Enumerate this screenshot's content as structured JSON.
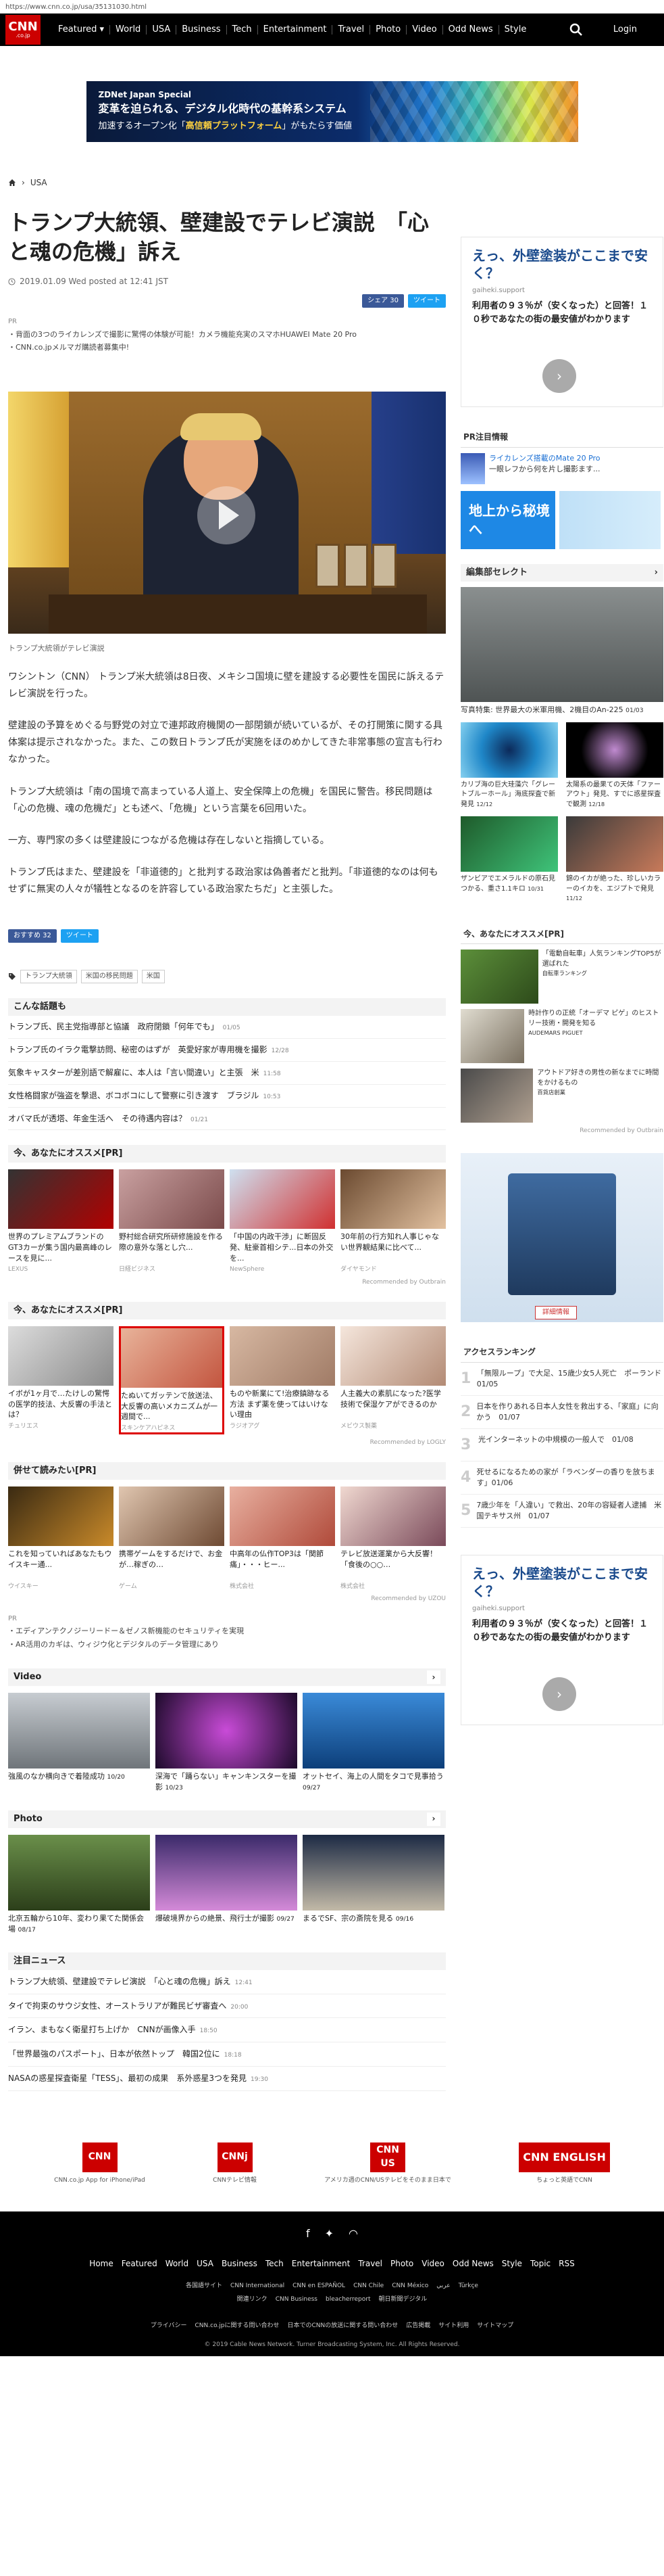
{
  "url": "https://www.cnn.co.jp/usa/35131030.html",
  "brand": {
    "logo": "CNN",
    "logo_sub": ".co.jp",
    "accent": "#cc0000"
  },
  "nav": {
    "items": [
      "Featured ▾",
      "World",
      "USA",
      "Business",
      "Tech",
      "Entertainment",
      "Travel",
      "Photo",
      "Video",
      "Odd News",
      "Style"
    ],
    "login": "Login"
  },
  "banner": {
    "l1": "ZDNet Japan Special",
    "l2": "変革を迫られる、デジタル化時代の基幹系システム",
    "l3a": "加速するオープン化「",
    "l3b": "高信頼プラットフォーム",
    "l3c": "」がもたらす価値"
  },
  "breadcrumb": {
    "home_icon": "home-icon",
    "section": "USA"
  },
  "article": {
    "title": "トランプ大統領、壁建設でテレビ演説　「心と魂の危機」訴え",
    "date": "2019.01.09 Wed posted at 12:41 JST",
    "share_fb": "シェア 30",
    "share_tw": "ツイート",
    "pr_label": "PR",
    "pr1": "・背面の3つのライカレンズで撮影に驚愕の体験が可能！カメラ機能充実のスマホHUAWEI Mate 20 Pro",
    "pr2": "・CNN.co.jpメルマガ購読者募集中!",
    "caption": "トランプ大統領がテレビ演説",
    "p1": "ワシントン（CNN） トランプ米大統領は8日夜、メキシコ国境に壁を建設する必要性を国民に訴えるテレビ演説を行った。",
    "p2": "壁建設の予算をめぐる与野党の対立で連邦政府機関の一部閉鎖が続いているが、その打開策に関する具体案は提示されなかった。また、この数日トランプ氏が実施をほのめかしてきた非常事態の宣言も行わなかった。",
    "p3": "トランプ大統領は「南の国境で高まっている人道上、安全保障上の危機」を国民に警告。移民問題は「心の危機、魂の危機だ」とも述べ、「危機」という言葉を6回用いた。",
    "p4": "一方、専門家の多くは壁建設につながる危機は存在しないと指摘している。",
    "p5": "トランプ氏はまた、壁建設を「非道徳的」と批判する政治家は偽善者だと批判。「非道徳的なのは何もせずに無実の人々が犠牲となるのを許容している政治家たちだ」と主張した。",
    "like": "おすすめ 32",
    "tags": [
      "トランプ大統領",
      "米国の移民問題",
      "米国"
    ]
  },
  "trending": {
    "title": "こんな話題も",
    "items": [
      {
        "t": "トランプ氏、民主党指導部と協議　政府閉鎖「何年でも」",
        "d": "01/05"
      },
      {
        "t": "トランプ氏のイラク電撃訪問、秘密のはずが　英愛好家が専用機を撮影",
        "d": "12/28"
      },
      {
        "t": "気象キャスターが差別語で解雇に、本人は「言い間違い」と主張　米",
        "d": "11:58"
      },
      {
        "t": "女性格闘家が強盗を撃退、ボコボコにして警察に引き渡す　ブラジル",
        "d": "10:53"
      },
      {
        "t": "オバマ氏が透塔、年金生活へ　その待遇内容は？",
        "d": "01/21"
      }
    ]
  },
  "rec1": {
    "title": "今、あなたにオススメ[PR]",
    "cards": [
      {
        "t": "世界のプレミアムブランドのGT3カーが集う国内最高峰のレースを見に...",
        "s": "LEXUS"
      },
      {
        "t": "野村総合研究所研修施設を作る際の意外な落とし穴...",
        "s": "日経ビジネス"
      },
      {
        "t": "「中国の内政干渉」に断固反発、駐豪首相シテ...日本の外交を...",
        "s": "NewSphere"
      },
      {
        "t": "30年前の行方知れ人事じゃない世界観結果に比べて...",
        "s": "ダイヤモンド"
      }
    ],
    "by": "Recommended by Outbrain"
  },
  "rec2": {
    "title": "今、あなたにオススメ[PR]",
    "cards": [
      {
        "t": "イボが1ヶ月で…たけしの驚愕の医学的技法、大反響の手法とは？",
        "s": "チュリエス"
      },
      {
        "t": "たぬいてガッテンで放送法、大反響の高いメカニズムが一週間で...",
        "s": "スキンケアハピネス"
      },
      {
        "t": "ものや新業にて!治療鎮跡なる方法 まず薬を使ってはいけない理由",
        "s": "ラジオアグ"
      },
      {
        "t": "人主義大の素肌になった?医学技術で保湿ケアができるのか",
        "s": "メビウス製薬"
      }
    ],
    "by": "Recommended by LOGLY"
  },
  "rec3": {
    "title": "併せて読みたい[PR]",
    "cards": [
      {
        "t": "これを知っていればあなたもウイスキー通...",
        "s": "ウイスキー"
      },
      {
        "t": "携帯ゲームをするだけで、お金が…稼ぎの…",
        "s": "ゲーム"
      },
      {
        "t": "中高年の仏作TOP3は「関節痛」・・・ヒー...",
        "s": "株式会社"
      },
      {
        "t": "テレビ放送運業から大反響！「食後の○○…",
        "s": "株式会社"
      }
    ],
    "by": "Recommended by UZOU"
  },
  "pr3": {
    "label": "PR",
    "l1": "・エディアンテクノジーリードー＆ゼノス新機能のセキュリティを実現",
    "l2": "・AR活用のカギは、ウィジウ化とデジタルのデータ管理にあり"
  },
  "video": {
    "title": "Video",
    "items": [
      {
        "t": "強風のなか横向きで着陸成功",
        "d": "10/20"
      },
      {
        "t": "深海で「踊らない」キャンキンスターを撮影",
        "d": "10/23"
      },
      {
        "t": "オットセイ、海上の人間をタコで見事拾う",
        "d": "09/27"
      }
    ]
  },
  "photo": {
    "title": "Photo",
    "items": [
      {
        "t": "北京五輪から10年、変わり果てた関係会場",
        "d": "08/17"
      },
      {
        "t": "爆破境界からの絶景、飛行士が撮影",
        "d": "09/27"
      },
      {
        "t": "まるでSF、宗の斎院を見る",
        "d": "09/16"
      }
    ]
  },
  "news": {
    "title": "注目ニュース",
    "items": [
      {
        "t": "トランプ大統領、壁建設でテレビ演説　「心と魂の危機」訴え",
        "d": "12:41"
      },
      {
        "t": "タイで拘束のサウジ女性、オーストラリアが難民ビザ審査へ",
        "d": "20:00"
      },
      {
        "t": "イラン、まもなく衛星打ち上げか　CNNが画像入手",
        "d": "18:50"
      },
      {
        "t": "「世界最強のパスポート」、日本が依然トップ　韓国2位に",
        "d": "18:18"
      },
      {
        "t": "NASAの惑星探査衛星「TESS」、最初の成果　系外惑星3つを発見",
        "d": "19:30"
      }
    ]
  },
  "side": {
    "ad_h": "えっ、外壁塗装がここまで安く？",
    "ad_s": "gaiheki.support",
    "ad_b": "利用者の９３％が（安くなった）と回答！１０秒であなたの街の最安値がわかります",
    "ad_go": "›",
    "pr_title": "PR注目情報",
    "pr_item": "ライカレンズ搭載のMate 20 Pro",
    "pr_item_desc": "一眼レフから何を片し撮影ます...",
    "pr_img_text": "地上から秘境へ",
    "pick_title": "編集部セレクト",
    "pick1": "写真特集: 世界最大の米軍用機、2機目のAn-225",
    "pick1d": "01/03",
    "pick2": "カリブ海の巨大珪藻穴「グレートブルーホール」海底探査で新発見",
    "pick2d": "12/12",
    "pick3": "太陽系の最果ての天体「ファーアウト」発見、すでに惑星探査で観測",
    "pick3d": "12/18",
    "pick4": "ザンビアでエメラルドの原石見つかる、重さ1.1キロ",
    "pick4d": "10/31",
    "pick5": "錦のイカが絶った、珍しいカラーのイカを、エジプトで発見",
    "pick5d": "11/12",
    "rec_title": "今、あなたにオススメ[PR]",
    "rec1": "「電動自転車」人気ランキングTOP5が選ばれた",
    "rec1s": "自転車ランキング",
    "rec2": "時計作りの正統「オーデマ ピゲ」のヒストリー技術・開発を知る",
    "rec2s": "AUDEMARS PIGUET",
    "rec3": "アウトドア好きの男性の新なまでに時間をかけるもの",
    "rec3s": "百貨店創業",
    "rec_by": "Recommended by Outbrain",
    "ad2_btn": "詳細情報",
    "rank_title": "アクセスランキング",
    "rank": [
      "「無限ループ」で大足、15歳少女5人死亡　ポーランド　01/05",
      "日本を作りあれる日本人女性を救出する、「家庭」に向かう　01/07",
      "光インターネットの中規模の一般人で　01/08",
      "死せるになるための家が「ラベンダーの香りを放ちます」01/06",
      "7歳少年を「人違い」で救出、20年の容疑者人逮捕　米国テキサス州　01/07"
    ]
  },
  "footer": {
    "apps": [
      "CNN.co.jp App for iPhone/iPad",
      "CNNテレビ情報",
      "アメリカ週のCNN/USテレビをそのまま日本で",
      "ちょっと英語でCNN"
    ],
    "app_logos": [
      "CNN",
      "CNNj",
      "CNN US",
      "CNN ENGLISH"
    ],
    "nav": [
      "Home",
      "Featured",
      "World",
      "USA",
      "Business",
      "Tech",
      "Entertainment",
      "Travel",
      "Photo",
      "Video",
      "Odd News",
      "Style",
      "Topic",
      "RSS"
    ],
    "row1": [
      "各国語サイト",
      "CNN International",
      "CNN en ESPAÑOL",
      "CNN Chile",
      "CNN México",
      "عربي",
      "Türkçe"
    ],
    "row2": [
      "関連リンク",
      "CNN Business",
      "bleacherreport",
      "朝日新聞デジタル"
    ],
    "row3": [
      "プライバシー",
      "CNN.co.jpに関する問い合わせ",
      "日本でのCNNの放送に関する問い合わせ",
      "広告掲載",
      "サイト利用",
      "サイトマップ"
    ],
    "copyright": "© 2019 Cable News Network. Turner Broadcasting System, Inc. All Rights Reserved."
  }
}
